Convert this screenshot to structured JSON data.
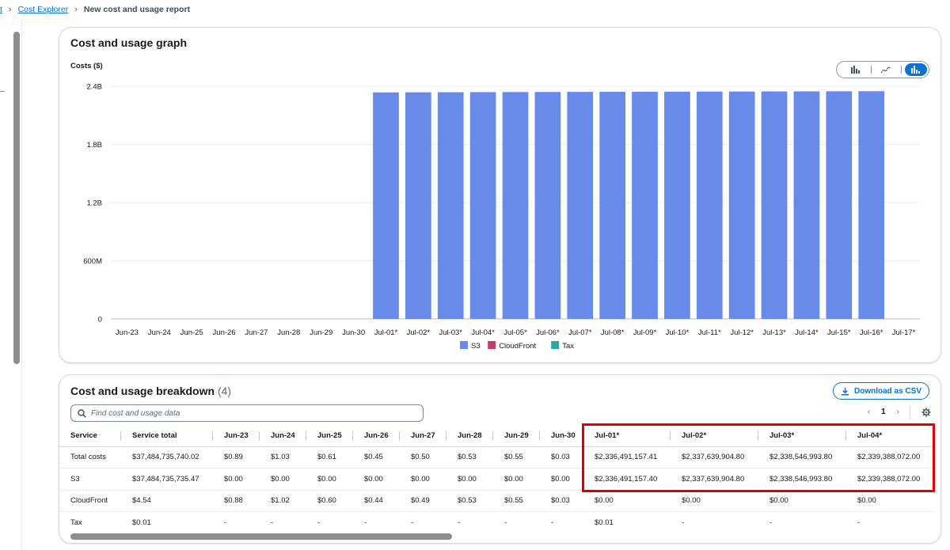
{
  "breadcrumb": {
    "parent": "t",
    "link": "Cost Explorer",
    "current": "New cost and usage report"
  },
  "graph": {
    "title": "Cost and usage graph",
    "ylabel": "Costs ($)",
    "chart_types": [
      "bar-chart-icon",
      "line-chart-icon",
      "stacked-bar-chart-icon"
    ],
    "active_chart_type": "stacked-bar-chart-icon"
  },
  "chart_data": {
    "type": "bar",
    "title": "",
    "xlabel": "",
    "ylabel": "Costs ($)",
    "ylim": [
      0,
      2400000000
    ],
    "y_ticks": [
      0,
      600000000,
      1200000000,
      1800000000,
      2400000000
    ],
    "y_tick_labels": [
      "0",
      "600M",
      "1.2B",
      "1.8B",
      "2.4B"
    ],
    "grid": true,
    "legend_position": "bottom-center",
    "categories": [
      "Jun-23",
      "Jun-24",
      "Jun-25",
      "Jun-26",
      "Jun-27",
      "Jun-28",
      "Jun-29",
      "Jun-30",
      "Jul-01*",
      "Jul-02*",
      "Jul-03*",
      "Jul-04*",
      "Jul-05*",
      "Jul-06*",
      "Jul-07*",
      "Jul-08*",
      "Jul-09*",
      "Jul-10*",
      "Jul-11*",
      "Jul-12*",
      "Jul-13*",
      "Jul-14*",
      "Jul-15*",
      "Jul-16*",
      "Jul-17*"
    ],
    "series": [
      {
        "name": "S3",
        "color": "#688ae8",
        "values": [
          0,
          0,
          0,
          0,
          0,
          0,
          0,
          0,
          2336491157.4,
          2337639904.8,
          2338546993.8,
          2339388072.0,
          2340200000,
          2341000000,
          2341800000,
          2342600000,
          2343400000,
          2344200000,
          2345000000,
          2345800000,
          2346600000,
          2347400000,
          2348200000,
          2349000000,
          0
        ]
      },
      {
        "name": "CloudFront",
        "color": "#c33d69",
        "values": [
          0.88,
          1.02,
          0.6,
          0.44,
          0.49,
          0.53,
          0.55,
          0.03,
          0,
          0,
          0,
          0,
          0,
          0,
          0,
          0,
          0,
          0,
          0,
          0,
          0,
          0,
          0,
          0,
          0
        ]
      },
      {
        "name": "Tax",
        "color": "#2ea597",
        "values": [
          0,
          0,
          0,
          0,
          0,
          0,
          0,
          0,
          0.01,
          0,
          0,
          0,
          0,
          0,
          0,
          0,
          0,
          0,
          0,
          0,
          0,
          0,
          0,
          0,
          0
        ]
      }
    ]
  },
  "breakdown": {
    "title": "Cost and usage breakdown",
    "count": "(4)",
    "download_label": "Download as CSV",
    "search_placeholder": "Find cost and usage data",
    "page": "1",
    "columns": [
      "Service",
      "Service total",
      "Jun-23",
      "Jun-24",
      "Jun-25",
      "Jun-26",
      "Jun-27",
      "Jun-28",
      "Jun-29",
      "Jun-30",
      "Jul-01*",
      "Jul-02*",
      "Jul-03*",
      "Jul-04*"
    ],
    "rows": [
      [
        "Total costs",
        "$37,484,735,740.02",
        "$0.89",
        "$1.03",
        "$0.61",
        "$0.45",
        "$0.50",
        "$0.53",
        "$0.55",
        "$0.03",
        "$2,336,491,157.41",
        "$2,337,639,904.80",
        "$2,338,546,993.80",
        "$2,339,388,072.00"
      ],
      [
        "S3",
        "$37,484,735,735.47",
        "$0.00",
        "$0.00",
        "$0.00",
        "$0.00",
        "$0.00",
        "$0.00",
        "$0.00",
        "$0.00",
        "$2,336,491,157.40",
        "$2,337,639,904.80",
        "$2,338,546,993.80",
        "$2,339,388,072.00"
      ],
      [
        "CloudFront",
        "$4.54",
        "$0.88",
        "$1.02",
        "$0.60",
        "$0.44",
        "$0.49",
        "$0.53",
        "$0.55",
        "$0.03",
        "$0.00",
        "$0.00",
        "$0.00",
        "$0.00"
      ],
      [
        "Tax",
        "$0.01",
        "-",
        "-",
        "-",
        "-",
        "-",
        "-",
        "-",
        "-",
        "$0.01",
        "-",
        "-",
        "-"
      ]
    ]
  },
  "colors": {
    "accent": "#0972d3",
    "highlight": "#e00000"
  }
}
